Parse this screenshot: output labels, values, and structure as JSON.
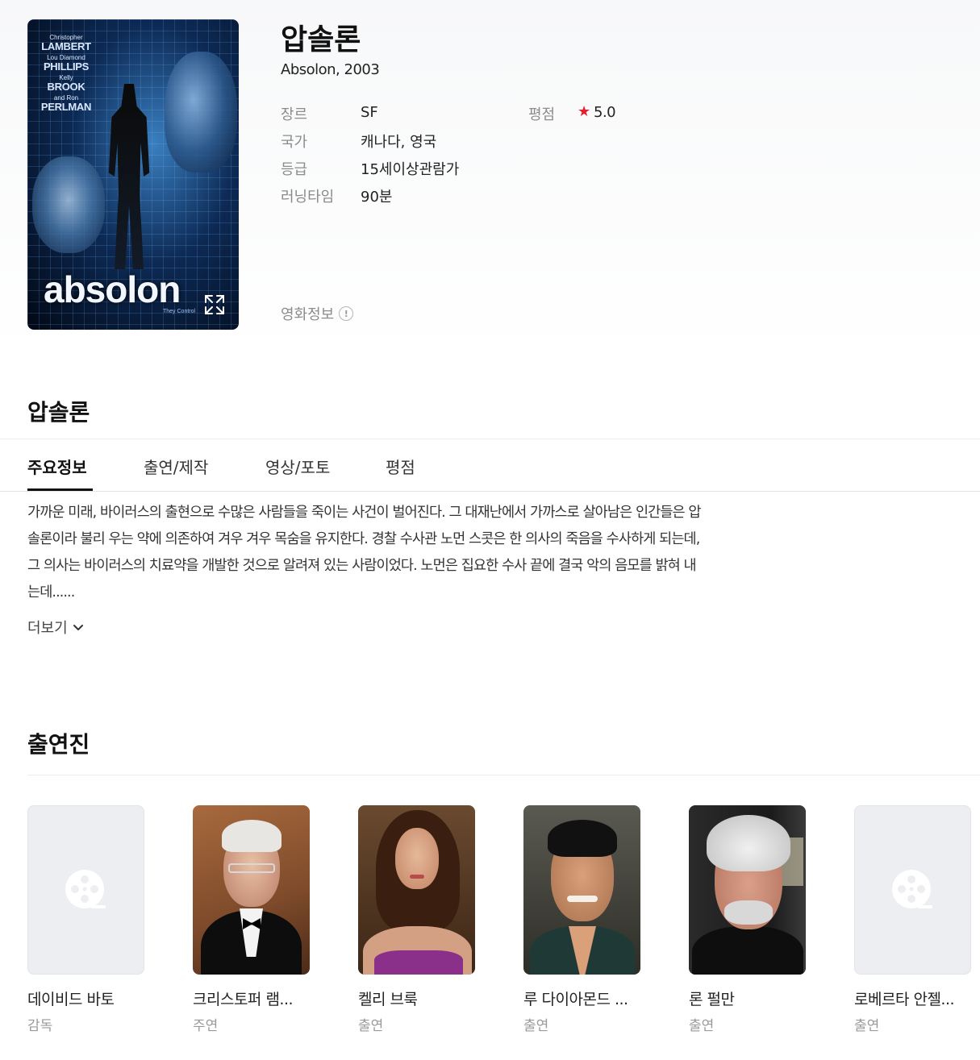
{
  "movie": {
    "title": "압솔론",
    "subtitle": "Absolon, 2003",
    "poster": {
      "credits": [
        {
          "small": "Christopher",
          "large": "LAMBERT"
        },
        {
          "small": "Lou Diamond",
          "large": "PHILLIPS"
        },
        {
          "small": "Kelly",
          "large": "BROOK"
        },
        {
          "small": "and Ron",
          "large": "PERLMAN"
        }
      ],
      "title": "absolon",
      "tagline": "They Control"
    },
    "info": [
      {
        "label": "장르",
        "value": "SF"
      },
      {
        "label": "국가",
        "value": "캐나다, 영국"
      },
      {
        "label": "등급",
        "value": "15세이상관람가"
      },
      {
        "label": "러닝타임",
        "value": "90분"
      }
    ],
    "rating": {
      "label": "평점",
      "value": "5.0",
      "star_color": "#e61e2b"
    },
    "movie_info_link": "영화정보"
  },
  "section": {
    "title": "압솔론",
    "tabs": [
      "주요정보",
      "출연/제작",
      "영상/포토",
      "평점"
    ],
    "active_tab": "주요정보"
  },
  "synopsis": {
    "lines": [
      "가까운 미래, 바이러스의 출현으로 수많은 사람들을 죽이는 사건이 벌어진다. 그 대재난에서 가까스로 살아남은 인간들은 압",
      "솔론이라 불리 우는 약에 의존하여 겨우 겨우 목숨을 유지한다. 경찰 수사관 노먼 스콧은 한 의사의 죽음을 수사하게 되는데,",
      "그 의사는 바이러스의 치료약을 개발한 것으로 알려져 있는 사람이었다. 노먼은 집요한 수사 끝에 결국 악의 음모를 밝혀 내",
      "는데......"
    ],
    "more_label": "더보기"
  },
  "cast": {
    "title": "출연진",
    "members": [
      {
        "name": "데이비드 바토",
        "role": "감독",
        "photo": "placeholder"
      },
      {
        "name": "크리스토퍼 램...",
        "role": "주연",
        "photo": "older-man-tuxedo"
      },
      {
        "name": "켈리 브룩",
        "role": "출연",
        "photo": "woman-purple-dress"
      },
      {
        "name": "루 다이아몬드 ...",
        "role": "출연",
        "photo": "man-dark-hair"
      },
      {
        "name": "론 펄만",
        "role": "출연",
        "photo": "man-white-hair"
      },
      {
        "name": "로베르타 안젤...",
        "role": "출연",
        "photo": "placeholder"
      }
    ]
  }
}
